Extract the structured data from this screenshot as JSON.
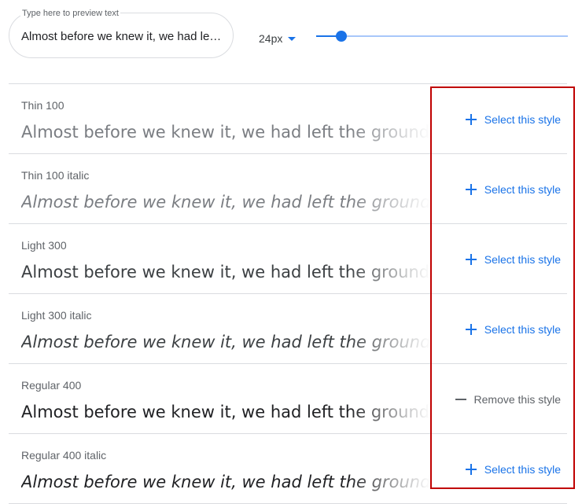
{
  "preview": {
    "label": "Type here to preview text",
    "value": "Almost before we knew it, we had left the ground."
  },
  "font_size": {
    "value": "24px",
    "slider_fraction": 0.1
  },
  "sample_text": "Almost before we knew it, we had left the ground.",
  "styles": [
    {
      "name": "Thin 100",
      "action": "Select this style",
      "action_icon": "plus-icon"
    },
    {
      "name": "Thin 100 italic",
      "action": "Select this style",
      "action_icon": "plus-icon"
    },
    {
      "name": "Light 300",
      "action": "Select this style",
      "action_icon": "plus-icon"
    },
    {
      "name": "Light 300 italic",
      "action": "Select this style",
      "action_icon": "plus-icon"
    },
    {
      "name": "Regular 400",
      "action": "Remove this style",
      "action_icon": "minus-icon"
    },
    {
      "name": "Regular 400 italic",
      "action": "Select this style",
      "action_icon": "plus-icon"
    }
  ],
  "colors": {
    "accent": "#1a73e8",
    "highlight": "#c00000"
  }
}
